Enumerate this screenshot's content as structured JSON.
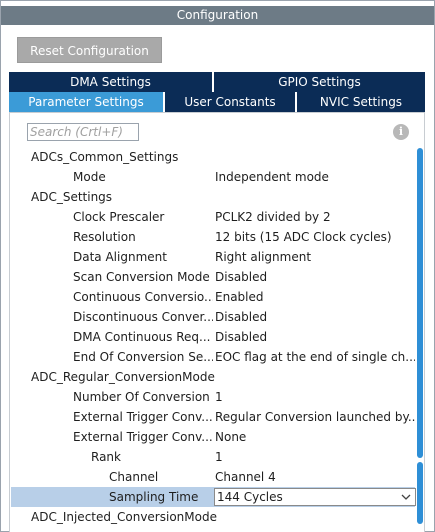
{
  "window": {
    "title": "Configuration"
  },
  "toolbar": {
    "reset_label": "Reset Configuration"
  },
  "tabs": {
    "row1": [
      {
        "label": "DMA Settings"
      },
      {
        "label": "GPIO Settings"
      }
    ],
    "row2": [
      {
        "label": "Parameter Settings",
        "active": true
      },
      {
        "label": "User Constants"
      },
      {
        "label": "NVIC Settings"
      }
    ]
  },
  "search": {
    "placeholder": "Search (Crtl+F)"
  },
  "colors": {
    "title_bar": "#6d7b86",
    "tab_dark": "#0b2c56",
    "tab_active": "#3b9bd7",
    "selected_row": "#b8cfe8",
    "scrollbar": "#2e8fd6"
  },
  "params": [
    {
      "label": "ADCs_Common_Settings",
      "value": ""
    },
    {
      "label": "Mode",
      "value": "Independent mode"
    },
    {
      "label": "ADC_Settings",
      "value": ""
    },
    {
      "label": "Clock Prescaler",
      "value": "PCLK2 divided by 2"
    },
    {
      "label": "Resolution",
      "value": "12 bits (15 ADC Clock cycles)"
    },
    {
      "label": "Data Alignment",
      "value": "Right alignment"
    },
    {
      "label": "Scan Conversion Mode",
      "value": "Disabled"
    },
    {
      "label": "Continuous Conversio...",
      "value": "Enabled"
    },
    {
      "label": "Discontinuous Conver...",
      "value": "Disabled"
    },
    {
      "label": "DMA Continuous Req...",
      "value": "Disabled"
    },
    {
      "label": "End Of Conversion Se...",
      "value": "EOC flag at the end of single ch..."
    },
    {
      "label": "ADC_Regular_ConversionMode",
      "value": ""
    },
    {
      "label": "Number Of Conversion",
      "value": "1"
    },
    {
      "label": "External Trigger Conv...",
      "value": "Regular Conversion launched by..."
    },
    {
      "label": "External Trigger Conv...",
      "value": "None"
    },
    {
      "label": "Rank",
      "value": "1"
    },
    {
      "label": "Channel",
      "value": "Channel 4"
    },
    {
      "label": "Sampling Time",
      "value": "144 Cycles"
    },
    {
      "label": "ADC_Injected_ConversionMode",
      "value": ""
    }
  ]
}
